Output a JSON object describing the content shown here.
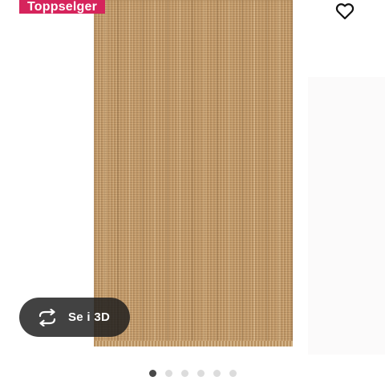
{
  "badge": {
    "label": "Toppselger",
    "color": "#d6245c"
  },
  "favorite": {
    "icon": "heart-icon"
  },
  "view_3d": {
    "label": "Se i 3D",
    "icon": "rotate-3d-icon"
  },
  "product_image": {
    "subject": "jute rug",
    "color": "#c49c6c"
  },
  "carousel": {
    "slide_count": 6,
    "active_index": 0,
    "active_color": "#484848",
    "inactive_color": "#dcdcdc"
  }
}
